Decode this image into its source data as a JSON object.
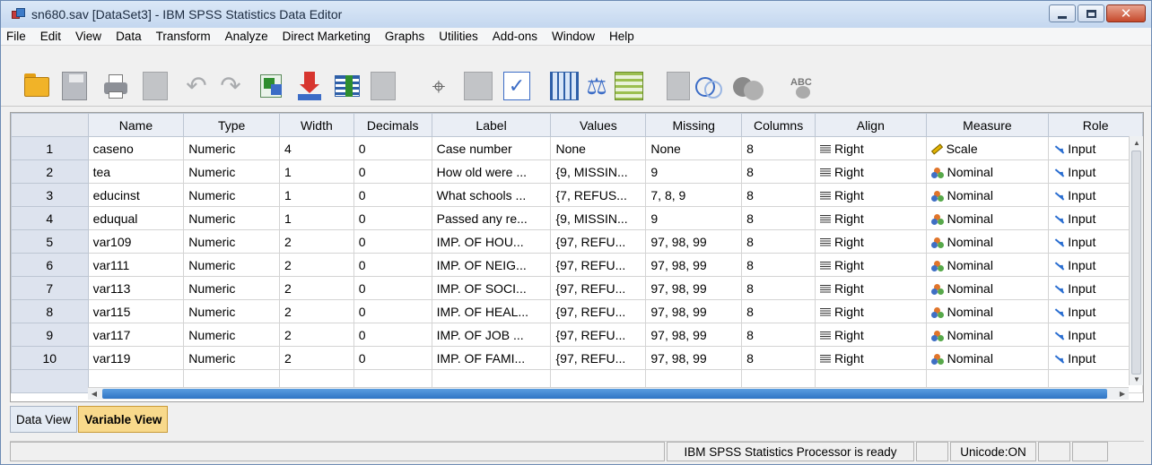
{
  "window": {
    "title": "sn680.sav [DataSet3] - IBM SPSS Statistics Data Editor"
  },
  "menu": [
    "File",
    "Edit",
    "View",
    "Data",
    "Transform",
    "Analyze",
    "Direct Marketing",
    "Graphs",
    "Utilities",
    "Add-ons",
    "Window",
    "Help"
  ],
  "toolbar": {
    "icons": [
      "open-folder-icon",
      "save-icon",
      "print-icon",
      "dialog-recall-icon",
      "undo-icon",
      "redo-icon",
      "go-to-case-icon",
      "go-to-variable-icon",
      "variables-icon",
      "run-descriptives-icon",
      "find-icon",
      "insert-cases-icon",
      "insert-variable-icon",
      "split-file-icon",
      "weight-cases-icon",
      "select-cases-icon",
      "value-labels-icon",
      "use-sets-icon",
      "show-all-variables-icon",
      "spell-check-icon"
    ],
    "abc_text": "ABC"
  },
  "table": {
    "columns": [
      "Name",
      "Type",
      "Width",
      "Decimals",
      "Label",
      "Values",
      "Missing",
      "Columns",
      "Align",
      "Measure",
      "Role"
    ],
    "rows": [
      {
        "n": "1",
        "name": "caseno",
        "type": "Numeric",
        "width": "4",
        "decimals": "0",
        "label": "Case number",
        "values": "None",
        "missing": "None",
        "columns": "8",
        "align": "Right",
        "measure": "Scale",
        "role": "Input"
      },
      {
        "n": "2",
        "name": "tea",
        "type": "Numeric",
        "width": "1",
        "decimals": "0",
        "label": "How old were ...",
        "values": "{9, MISSIN...",
        "missing": "9",
        "columns": "8",
        "align": "Right",
        "measure": "Nominal",
        "role": "Input"
      },
      {
        "n": "3",
        "name": "educinst",
        "type": "Numeric",
        "width": "1",
        "decimals": "0",
        "label": "What schools ...",
        "values": "{7, REFUS...",
        "missing": "7, 8, 9",
        "columns": "8",
        "align": "Right",
        "measure": "Nominal",
        "role": "Input"
      },
      {
        "n": "4",
        "name": "eduqual",
        "type": "Numeric",
        "width": "1",
        "decimals": "0",
        "label": "Passed any re...",
        "values": "{9, MISSIN...",
        "missing": "9",
        "columns": "8",
        "align": "Right",
        "measure": "Nominal",
        "role": "Input"
      },
      {
        "n": "5",
        "name": "var109",
        "type": "Numeric",
        "width": "2",
        "decimals": "0",
        "label": "IMP. OF HOU...",
        "values": "{97, REFU...",
        "missing": "97, 98, 99",
        "columns": "8",
        "align": "Right",
        "measure": "Nominal",
        "role": "Input"
      },
      {
        "n": "6",
        "name": "var111",
        "type": "Numeric",
        "width": "2",
        "decimals": "0",
        "label": "IMP. OF NEIG...",
        "values": "{97, REFU...",
        "missing": "97, 98, 99",
        "columns": "8",
        "align": "Right",
        "measure": "Nominal",
        "role": "Input"
      },
      {
        "n": "7",
        "name": "var113",
        "type": "Numeric",
        "width": "2",
        "decimals": "0",
        "label": "IMP. OF SOCI...",
        "values": "{97, REFU...",
        "missing": "97, 98, 99",
        "columns": "8",
        "align": "Right",
        "measure": "Nominal",
        "role": "Input"
      },
      {
        "n": "8",
        "name": "var115",
        "type": "Numeric",
        "width": "2",
        "decimals": "0",
        "label": "IMP. OF HEAL...",
        "values": "{97, REFU...",
        "missing": "97, 98, 99",
        "columns": "8",
        "align": "Right",
        "measure": "Nominal",
        "role": "Input"
      },
      {
        "n": "9",
        "name": "var117",
        "type": "Numeric",
        "width": "2",
        "decimals": "0",
        "label": "IMP. OF JOB ...",
        "values": "{97, REFU...",
        "missing": "97, 98, 99",
        "columns": "8",
        "align": "Right",
        "measure": "Nominal",
        "role": "Input"
      },
      {
        "n": "10",
        "name": "var119",
        "type": "Numeric",
        "width": "2",
        "decimals": "0",
        "label": "IMP. OF FAMI...",
        "values": "{97, REFU...",
        "missing": "97, 98, 99",
        "columns": "8",
        "align": "Right",
        "measure": "Nominal",
        "role": "Input"
      }
    ]
  },
  "tabs": [
    {
      "label": "Data View",
      "active": false
    },
    {
      "label": "Variable View",
      "active": true
    }
  ],
  "status": {
    "processor": "IBM SPSS Statistics Processor is ready",
    "unicode": "Unicode:ON"
  },
  "colors": {
    "active_tab": "#f8d98b",
    "header_bg": "#eaeef5",
    "scroll_thumb": "#2f74c4",
    "close_button": "#c64a2c"
  }
}
